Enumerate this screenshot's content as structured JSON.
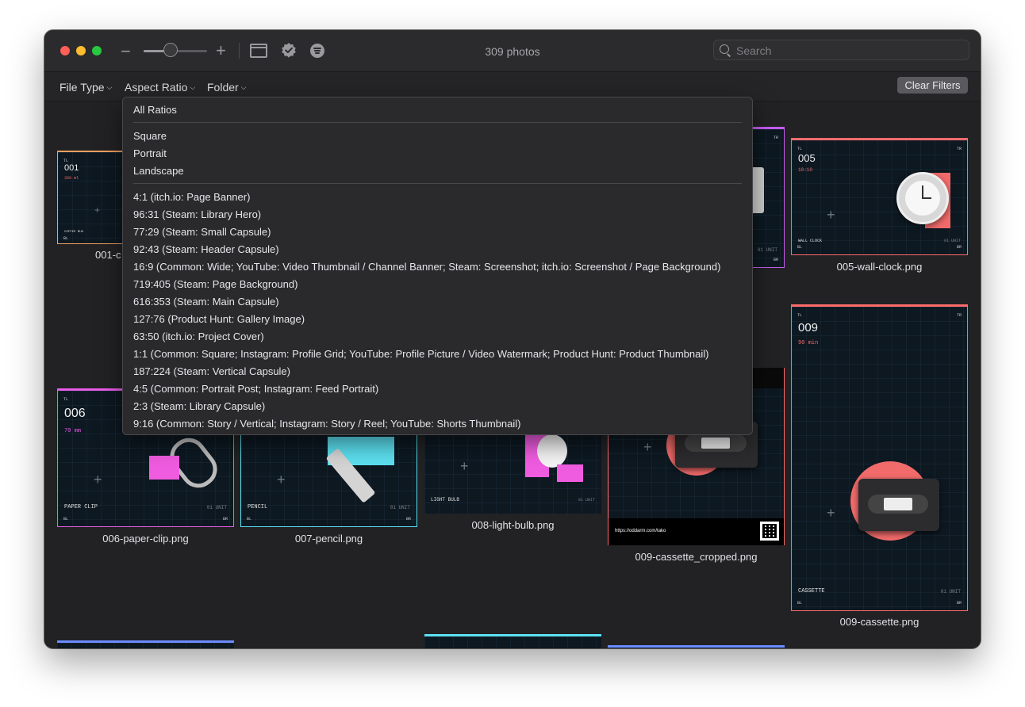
{
  "window": {
    "title": "309 photos"
  },
  "toolbar": {
    "zoom_out_icon": "minus-icon",
    "zoom_in_icon": "plus-icon",
    "zoom_level": 0.42,
    "search_placeholder": "Search"
  },
  "filters": {
    "file_type": "File Type",
    "aspect_ratio": "Aspect Ratio",
    "folder": "Folder",
    "clear": "Clear Filters"
  },
  "dropdown": {
    "all": "All Ratios",
    "shapes": [
      "Square",
      "Portrait",
      "Landscape"
    ],
    "ratios": [
      "4:1 (itch.io: Page Banner)",
      "96:31 (Steam: Library Hero)",
      "77:29 (Steam: Small Capsule)",
      "92:43 (Steam: Header Capsule)",
      "16:9 (Common: Wide; YouTube: Video Thumbnail / Channel Banner; Steam: Screenshot; itch.io: Screenshot / Page Background)",
      "719:405 (Steam: Page Background)",
      "616:353 (Steam: Main Capsule)",
      "127:76 (Product Hunt: Gallery Image)",
      "63:50 (itch.io: Project Cover)",
      "1:1 (Common: Square; Instagram: Profile Grid; YouTube: Profile Picture / Video Watermark; Product Hunt: Product Thumbnail)",
      "187:224 (Steam: Vertical Capsule)",
      "4:5 (Common: Portrait Post; Instagram: Feed Portrait)",
      "2:3 (Steam: Library Capsule)",
      "9:16 (Common: Story / Vertical; Instagram: Story / Reel; YouTube: Shorts Thumbnail)"
    ]
  },
  "photos": {
    "p001": {
      "caption": "001-c",
      "num": "001",
      "sub": "350 ml",
      "label": "COFFEE MUG",
      "tl": "TL",
      "bl": "BL"
    },
    "p003": {
      "tr": "TR",
      "unit": "01 UNIT",
      "br": "BR"
    },
    "p005": {
      "caption": "005-wall-clock.png",
      "num": "005",
      "sub": "10:10",
      "label": "WALL CLOCK",
      "unit": "01 UNIT",
      "tl": "TL",
      "tr": "TR",
      "bl": "BL",
      "br": "BR"
    },
    "p006": {
      "caption": "006-paper-clip.png",
      "num": "006",
      "sub": "70 mm",
      "label": "PAPER CLIP",
      "unit": "01 UNIT",
      "tl": "TL",
      "bl": "BL",
      "br": "BR"
    },
    "p007": {
      "caption": "007-pencil.png",
      "label": "PENCIL",
      "unit": "01 UNIT",
      "bl": "BL",
      "br": "BR"
    },
    "p008": {
      "caption": "008-light-bulb.png",
      "label": "LIGHT BULB",
      "unit": "01 UNIT"
    },
    "p009c": {
      "caption": "009-cassette_cropped.png",
      "url": "https://oddarm.com/tako"
    },
    "p009": {
      "caption": "009-cassette.png",
      "num": "009",
      "sub": "90 min",
      "label": "CASSETTE",
      "unit": "01 UNIT",
      "tl": "TL",
      "tr": "TR",
      "bl": "BL",
      "br": "BR"
    }
  },
  "colors": {
    "accent_orange": "#f0a060",
    "accent_purple": "#c65cf0",
    "accent_red": "#ff6b6b",
    "accent_magenta": "#e85ce8",
    "accent_cyan": "#5ce0f0",
    "accent_blue": "#6b8cff",
    "sticky_pink": "#f05ce0",
    "salmon": "#f26b6b"
  }
}
